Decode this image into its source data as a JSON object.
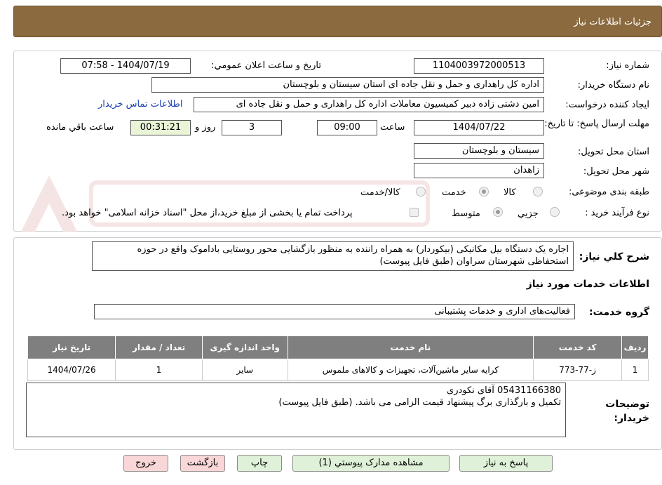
{
  "header": {
    "title": "جزئیات اطلاعات نیاز"
  },
  "form": {
    "need_number_label": "شماره نیاز:",
    "need_number_value": "1104003972000513",
    "announce_label": "تاریخ و ساعت اعلان عمومي:",
    "announce_value": "1404/07/19 - 07:58",
    "buyer_org_label": "نام دستگاه خریدار:",
    "buyer_org_value": "اداره کل راهداری و حمل و نقل جاده ای استان سیستان و بلوچستان",
    "requester_label": "ایجاد کننده درخواست:",
    "requester_value": "امین دشتی زاده دبیر کمیسیون معاملات اداره کل راهداری و حمل و نقل جاده ای",
    "contact_link": "اطلاعات تماس خریدار",
    "deadline_label": "مهلت ارسال پاسخ: تا تاریخ:",
    "deadline_date": "1404/07/22",
    "hour_label": "ساعت",
    "deadline_time": "09:00",
    "days_value": "3",
    "days_label": "روز و",
    "remaining_time": "00:31:21",
    "remaining_label": "ساعت باقي مانده",
    "province_label": "استان محل تحویل:",
    "province_value": "سیستان و بلوچستان",
    "city_label": "شهر محل تحویل:",
    "city_value": "زاهدان",
    "category_label": "طبقه بندی موضوعی:",
    "category_options": [
      "کالا",
      "خدمت",
      "کالا/خدمت"
    ],
    "process_label": "نوع فرآیند خرید :",
    "process_options": [
      "جزیي",
      "متوسط"
    ],
    "payment_note": "پرداخت تمام یا بخشی از مبلغ خرید،از محل \"اسناد خزانه اسلامی\" خواهد بود."
  },
  "description": {
    "label": "شرح کلي نیاز:",
    "text": "اجاره یک دستگاه بیل مکانیکی (بیکوردار) به همراه راننده به منظور بازگشایی محور روستایی باداموک واقع در حوزه استحفاظی شهرستان سراوان (طبق فایل پیوست)"
  },
  "services": {
    "section_title": "اطلاعات خدمات مورد نیاز",
    "group_label": "گروه خدمت:",
    "group_value": "فعالیت‌های اداری و خدمات پشتیبانی",
    "columns": [
      "ردیف",
      "کد خدمت",
      "نام خدمت",
      "واحد اندازه گیری",
      "تعداد / مقدار",
      "تاریخ نیاز"
    ],
    "rows": [
      [
        "1",
        "ز-77-773",
        "کرایه سایر ماشین‌آلات، تجهیزات و کالاهای ملموس",
        "سایر",
        "1",
        "1404/07/26"
      ]
    ]
  },
  "buyer_notes": {
    "label": "توضیحات خریدار:",
    "line1": "05431166380 آقای نکودری",
    "line2": "تکمیل و بارگذاری برگ پیشنهاد قیمت الزامی می باشد. (طبق فایل پیوست)"
  },
  "buttons": {
    "reply": "پاسخ به نیاز",
    "attachments": "مشاهده مدارک پیوستي (1)",
    "print": "چاپ",
    "back": "بازگشت",
    "exit": "خروج"
  },
  "colors": {
    "header_bg": "#8b6a3f",
    "table_header_bg": "#7f7f7f",
    "button_green": "#dff1d8",
    "button_red": "#f9d7d9"
  }
}
